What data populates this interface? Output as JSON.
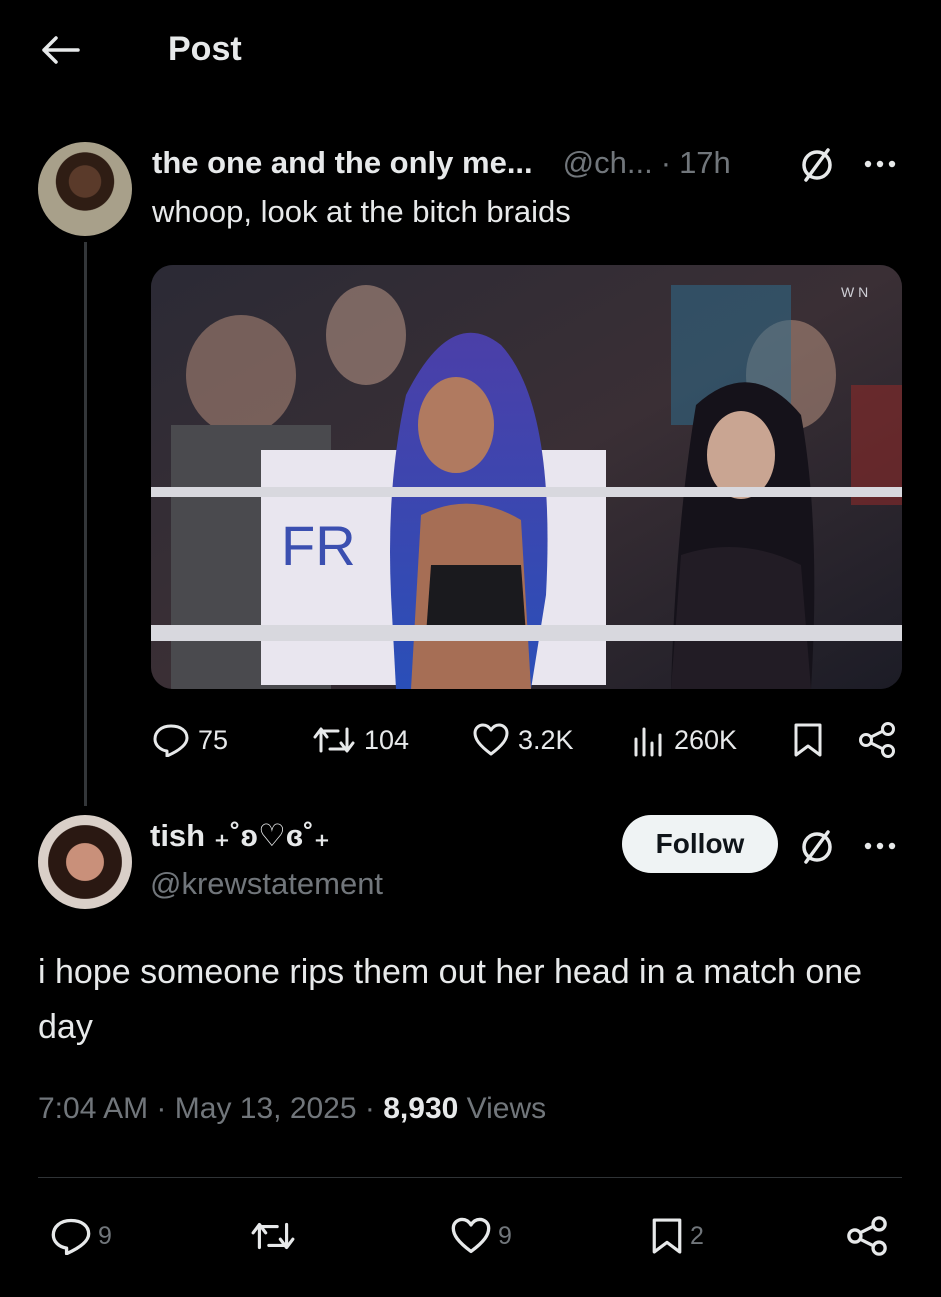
{
  "header": {
    "title": "Post"
  },
  "original_post": {
    "display_name": "the one and the only me...",
    "handle": "@ch...",
    "separator": "·",
    "time": "17h",
    "text": "whoop, look at the bitch braids",
    "stats": {
      "replies": "75",
      "reposts": "104",
      "likes": "3.2K",
      "views": "260K"
    }
  },
  "reply": {
    "display_name": "tish ₊˚ʚ♡ɞ˚₊",
    "handle": "@krewstatement",
    "follow_label": "Follow",
    "text": "i hope someone rips them out her head in a match one day",
    "time": "7:04 AM",
    "sep1": "·",
    "date": "May 13, 2025",
    "sep2": "·",
    "views_count": "8,930",
    "views_label": "Views",
    "stats": {
      "replies": "9",
      "likes": "9",
      "bookmarks": "2"
    }
  },
  "colors": {
    "background": "#000000",
    "text": "#e7e9ea",
    "muted": "#71767b",
    "follow_bg": "#eff3f4"
  },
  "icons": [
    "back-arrow-icon",
    "no-symbol-icon",
    "more-icon",
    "reply-icon",
    "repost-icon",
    "like-icon",
    "views-icon",
    "bookmark-icon",
    "share-icon"
  ]
}
